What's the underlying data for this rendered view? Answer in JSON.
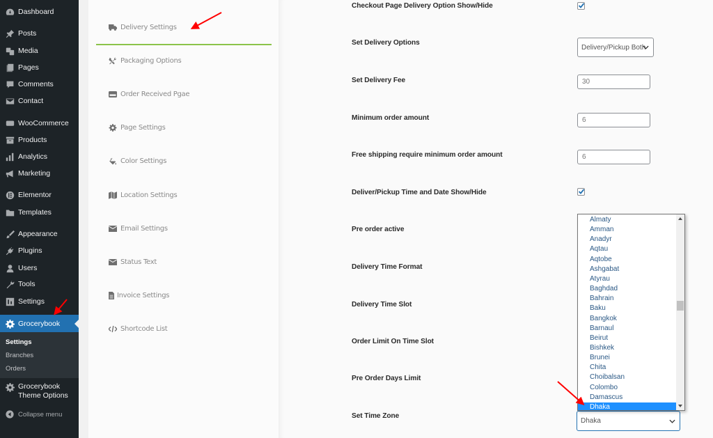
{
  "admin_menu": {
    "items": [
      {
        "label": "Dashboard",
        "icon": "dashboard-icon"
      },
      {
        "label": "Posts",
        "icon": "pin-icon"
      },
      {
        "label": "Media",
        "icon": "media-icon"
      },
      {
        "label": "Pages",
        "icon": "pages-icon"
      },
      {
        "label": "Comments",
        "icon": "comment-icon"
      },
      {
        "label": "Contact",
        "icon": "envelope-icon"
      },
      {
        "label": "WooCommerce",
        "icon": "woocommerce-icon"
      },
      {
        "label": "Products",
        "icon": "archive-icon"
      },
      {
        "label": "Analytics",
        "icon": "bar-chart-icon"
      },
      {
        "label": "Marketing",
        "icon": "megaphone-icon"
      },
      {
        "label": "Elementor",
        "icon": "elementor-icon"
      },
      {
        "label": "Templates",
        "icon": "folder-icon"
      },
      {
        "label": "Appearance",
        "icon": "paintbrush-icon"
      },
      {
        "label": "Plugins",
        "icon": "plug-icon"
      },
      {
        "label": "Users",
        "icon": "user-icon"
      },
      {
        "label": "Tools",
        "icon": "wrench-icon"
      },
      {
        "label": "Settings",
        "icon": "settings-icon"
      },
      {
        "label": "Grocerybook",
        "icon": "gear-icon",
        "current": true
      }
    ],
    "submenu": [
      {
        "label": "Settings",
        "current": true
      },
      {
        "label": "Branches"
      },
      {
        "label": "Orders"
      }
    ],
    "theme_options": {
      "line1": "Grocerybook",
      "line2": "Theme Options"
    },
    "collapse_label": "Collapse menu"
  },
  "settings_nav": {
    "active_color": "#8bc34a",
    "items": [
      {
        "label": "Delivery Settings",
        "icon": "truck-icon",
        "active": true
      },
      {
        "label": "Packaging Options",
        "icon": "tools-icon"
      },
      {
        "label": "Order Received Pgae",
        "icon": "credit-card-icon"
      },
      {
        "label": "Page Settings",
        "icon": "cog-icon"
      },
      {
        "label": "Color Settings",
        "icon": "paint-bucket-icon"
      },
      {
        "label": "Location Settings",
        "icon": "map-icon"
      },
      {
        "label": "Email Settings",
        "icon": "envelope-icon"
      },
      {
        "label": "Status Text",
        "icon": "envelope-icon"
      },
      {
        "label": "Invoice Settings",
        "icon": "file-icon"
      },
      {
        "label": "Shortcode List",
        "icon": "code-icon"
      }
    ]
  },
  "delivery_settings": {
    "rows": [
      {
        "label": "Checkout Page Delivery Option Show/Hide",
        "type": "checkbox",
        "checked": true
      },
      {
        "label": "Set Delivery Options",
        "type": "select",
        "value": "Delivery/Pickup Both"
      },
      {
        "label": "Set Delivery Fee",
        "type": "text",
        "value": "30"
      },
      {
        "label": "Minimum order amount",
        "type": "text",
        "value": "6"
      },
      {
        "label": "Free shipping require minimum order amount",
        "type": "text",
        "value": "6"
      },
      {
        "label": "Deliver/Pickup Time and Date Show/Hide",
        "type": "checkbox",
        "checked": true
      },
      {
        "label": "Pre order active",
        "type": "checkbox"
      },
      {
        "label": "Delivery Time Format",
        "type": "select"
      },
      {
        "label": "Delivery Time Slot",
        "type": "select"
      },
      {
        "label": "Order Limit On Time Slot",
        "type": "text"
      },
      {
        "label": "Pre Order Days Limit",
        "type": "text"
      },
      {
        "label": "Set Time Zone",
        "type": "select",
        "value": "Dhaka"
      }
    ],
    "timezone_dropdown": {
      "open": true,
      "options": [
        "Almaty",
        "Amman",
        "Anadyr",
        "Aqtau",
        "Aqtobe",
        "Ashgabat",
        "Atyrau",
        "Baghdad",
        "Bahrain",
        "Baku",
        "Bangkok",
        "Barnaul",
        "Beirut",
        "Bishkek",
        "Brunei",
        "Chita",
        "Choibalsan",
        "Colombo",
        "Damascus",
        "Dhaka"
      ],
      "selected": "Dhaka",
      "highlight_color": "#1e90ff"
    }
  },
  "colors": {
    "sidebar_bg": "#1d2327",
    "sidebar_current": "#2271b1",
    "annotation_arrow": "#ff0000"
  }
}
